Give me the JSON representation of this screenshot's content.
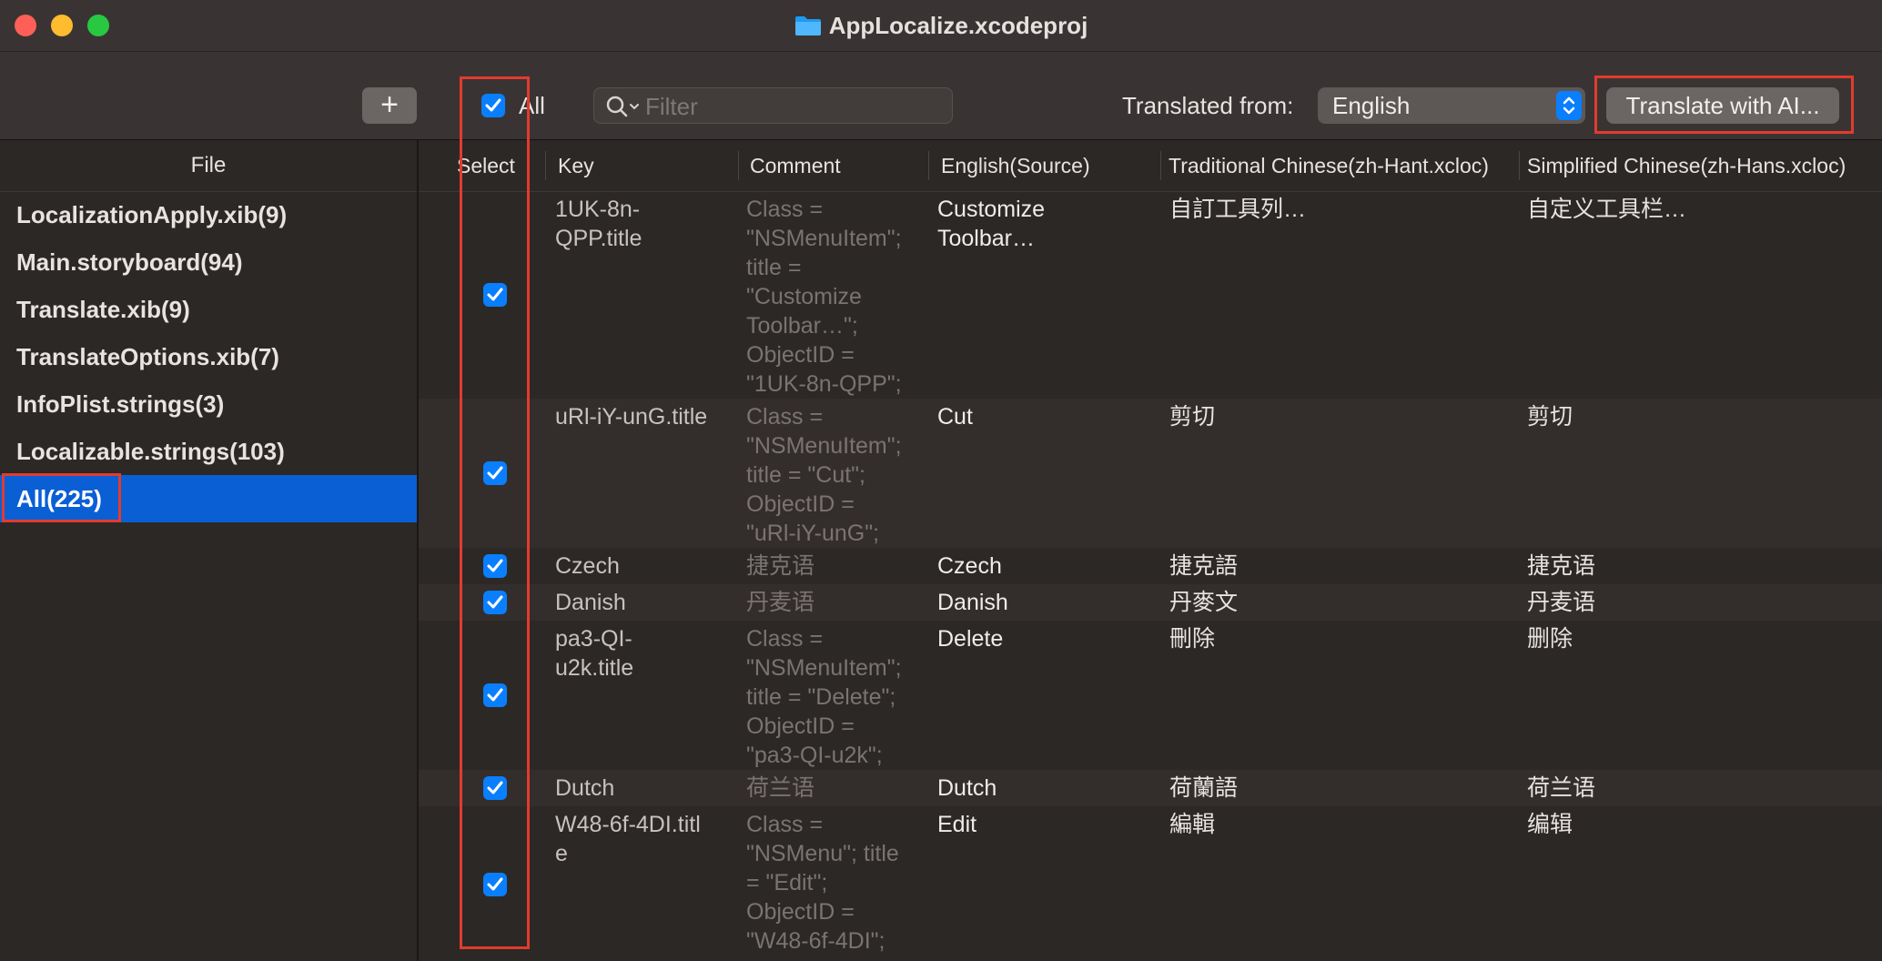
{
  "window": {
    "title": "AppLocalize.xcodeproj"
  },
  "toolbar": {
    "add_label": "+",
    "all_label": "All",
    "all_checked": true,
    "filter_placeholder": "Filter",
    "translated_from_label": "Translated from:",
    "source_language": "English",
    "translate_button": "Translate with AI..."
  },
  "sidebar": {
    "header": "File",
    "items": [
      {
        "label": "LocalizationApply.xib(9)"
      },
      {
        "label": "Main.storyboard(94)"
      },
      {
        "label": "Translate.xib(9)"
      },
      {
        "label": "TranslateOptions.xib(7)"
      },
      {
        "label": "InfoPlist.strings(3)"
      },
      {
        "label": "Localizable.strings(103)"
      },
      {
        "label": "All(225)",
        "selected": true
      }
    ]
  },
  "table": {
    "columns": {
      "select": "Select",
      "key": "Key",
      "comment": "Comment",
      "source": "English(Source)",
      "hant": "Traditional Chinese(zh-Hant.xcloc)",
      "hans": "Simplified Chinese(zh-Hans.xcloc)"
    },
    "rows": [
      {
        "checked": true,
        "key": "1UK-8n-\nQPP.title",
        "comment": "Class =\n\"NSMenuItem\";\ntitle =\n\"Customize\nToolbar…\";\nObjectID =\n\"1UK-8n-QPP\";",
        "source": "Customize\nToolbar…",
        "hant": "自訂工具列…",
        "hans": "自定义工具栏…"
      },
      {
        "checked": true,
        "key": "uRl-iY-unG.title",
        "comment": "Class =\n\"NSMenuItem\";\ntitle = \"Cut\";\nObjectID =\n\"uRl-iY-unG\";",
        "source": "Cut",
        "hant": "剪切",
        "hans": "剪切"
      },
      {
        "checked": true,
        "key": "Czech",
        "comment": "捷克语",
        "source": "Czech",
        "hant": "捷克語",
        "hans": "捷克语"
      },
      {
        "checked": true,
        "key": "Danish",
        "comment": "丹麦语",
        "source": "Danish",
        "hant": "丹麥文",
        "hans": "丹麦语"
      },
      {
        "checked": true,
        "key": "pa3-QI-\nu2k.title",
        "comment": "Class =\n\"NSMenuItem\";\ntitle = \"Delete\";\nObjectID =\n\"pa3-QI-u2k\";",
        "source": "Delete",
        "hant": "刪除",
        "hans": "删除"
      },
      {
        "checked": true,
        "key": "Dutch",
        "comment": "荷兰语",
        "source": "Dutch",
        "hant": "荷蘭語",
        "hans": "荷兰语"
      },
      {
        "checked": true,
        "key": "W48-6f-4DI.titl\ne",
        "comment": "Class =\n\"NSMenu\"; title\n= \"Edit\";\nObjectID =\n\"W48-6f-4DI\";",
        "source": "Edit",
        "hant": "編輯",
        "hans": "编辑"
      }
    ]
  },
  "colors": {
    "accent": "#0a7ffe",
    "selection": "#0a5fd4",
    "annotation": "#e23b2e"
  },
  "icons": {
    "folder": "folder-icon",
    "search": "search-icon",
    "checkmark": "checkmark-icon",
    "stepper": "chevron-updown-icon"
  }
}
